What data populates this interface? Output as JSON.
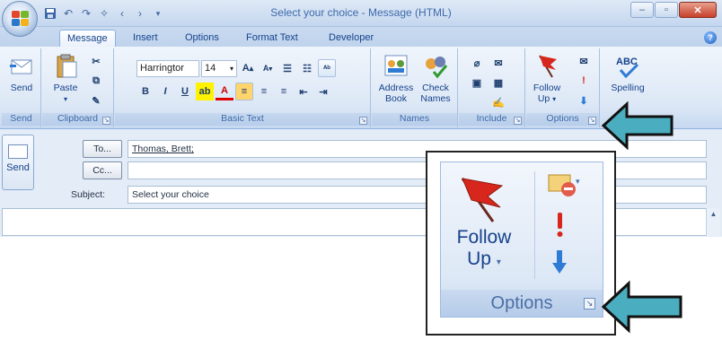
{
  "window": {
    "title": "Select your choice - Message (HTML)",
    "qat_icons": [
      "save-icon",
      "undo-icon",
      "redo-icon",
      "back-icon",
      "forward-icon",
      "customize-icon"
    ]
  },
  "tabs": [
    {
      "label": "Message",
      "active": true
    },
    {
      "label": "Insert",
      "active": false
    },
    {
      "label": "Options",
      "active": false
    },
    {
      "label": "Format Text",
      "active": false
    },
    {
      "label": "Developer",
      "active": false
    }
  ],
  "ribbon": {
    "send": {
      "button": "Send",
      "group": "Send"
    },
    "clipboard": {
      "paste": "Paste",
      "group": "Clipboard"
    },
    "basic_text": {
      "font": "Harringtor",
      "size": "14",
      "group": "Basic Text"
    },
    "names": {
      "address_book_1": "Address",
      "address_book_2": "Book",
      "check_names_1": "Check",
      "check_names_2": "Names",
      "group": "Names"
    },
    "include": {
      "group": "Include"
    },
    "options": {
      "follow_up_1": "Follow",
      "follow_up_2": "Up",
      "group": "Options"
    },
    "proofing": {
      "spelling": "Spelling",
      "abc": "ABC"
    }
  },
  "compose": {
    "send": "Send",
    "to_button": "To...",
    "cc_button": "Cc...",
    "subject_label": "Subject:",
    "to_value": "Thomas, Brett;",
    "cc_value": "",
    "subject_value": "Select your choice"
  },
  "zoom": {
    "follow_1": "Follow",
    "follow_2": "Up",
    "group": "Options"
  },
  "colors": {
    "arrow_fill": "#4aaec0",
    "flag_red": "#d7261b",
    "accent": "#15428b"
  }
}
